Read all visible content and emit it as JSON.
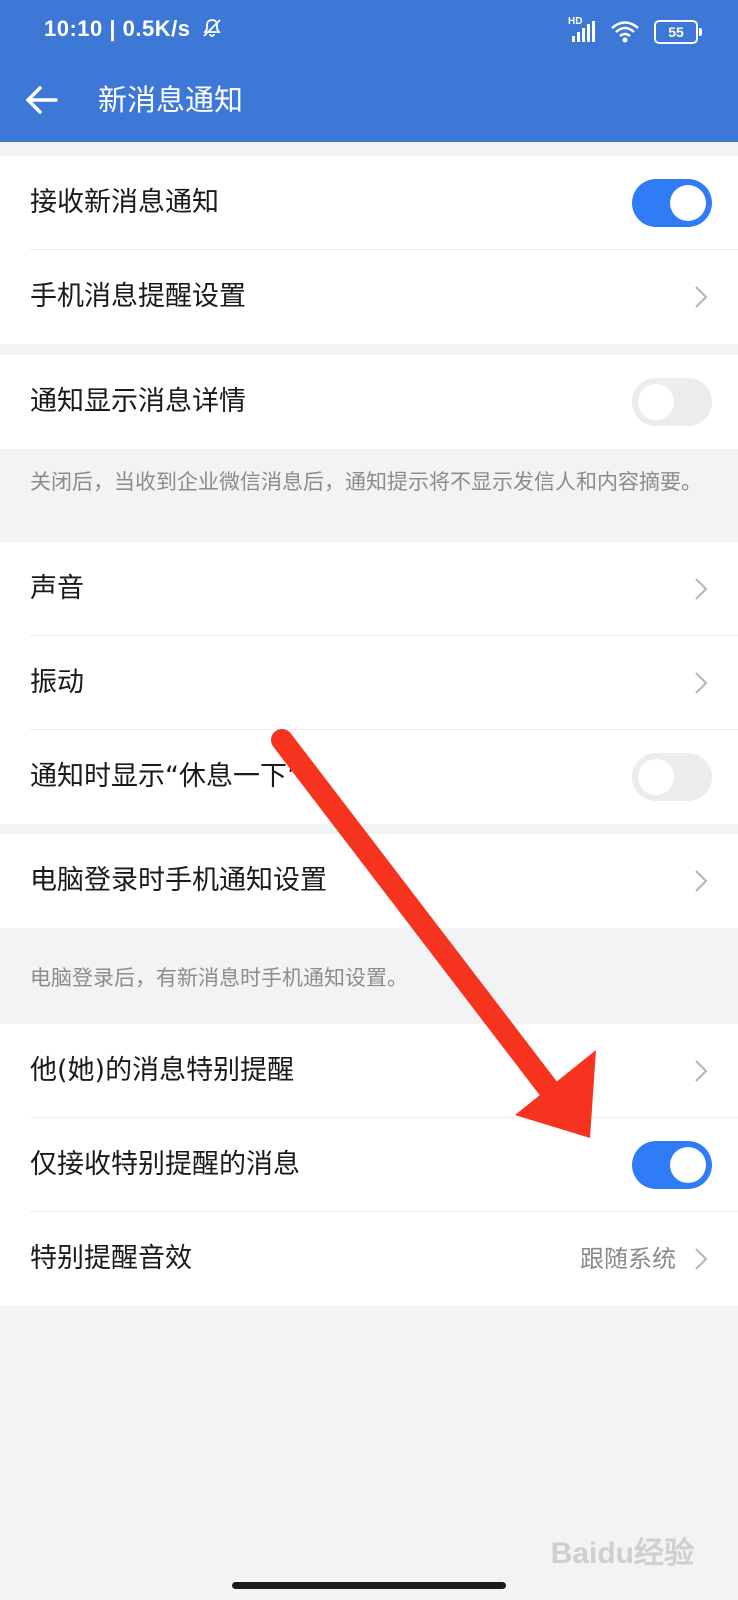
{
  "status_bar": {
    "time_speed": "10:10 | 0.5K/s",
    "network": "HD",
    "battery": "55"
  },
  "app_bar": {
    "title": "新消息通知"
  },
  "groups": [
    {
      "items": [
        {
          "label": "接收新消息通知",
          "toggle": "on"
        },
        {
          "label": "手机消息提醒设置"
        }
      ]
    },
    {
      "items": [
        {
          "label": "通知显示消息详情",
          "toggle": "off"
        }
      ],
      "note": "关闭后，当收到企业微信消息后，通知提示将不显示发信人和内容摘要。"
    },
    {
      "items": [
        {
          "label": "声音"
        },
        {
          "label": "振动"
        },
        {
          "label": "通知时显示“休息一下”",
          "toggle": "off"
        }
      ]
    },
    {
      "items": [
        {
          "label": "电脑登录时手机通知设置"
        }
      ],
      "note": "电脑登录后，有新消息时手机通知设置。"
    },
    {
      "items": [
        {
          "label": "他(她)的消息特别提醒"
        },
        {
          "label": "仅接收特别提醒的消息",
          "toggle": "on"
        },
        {
          "label": "特别提醒音效",
          "value": "跟随系统"
        }
      ]
    }
  ],
  "watermark": "Baidu经验",
  "colors": {
    "primary": "#3d78d6",
    "toggle_on": "#2f7cf6",
    "annotation_arrow": "#f5331e"
  }
}
